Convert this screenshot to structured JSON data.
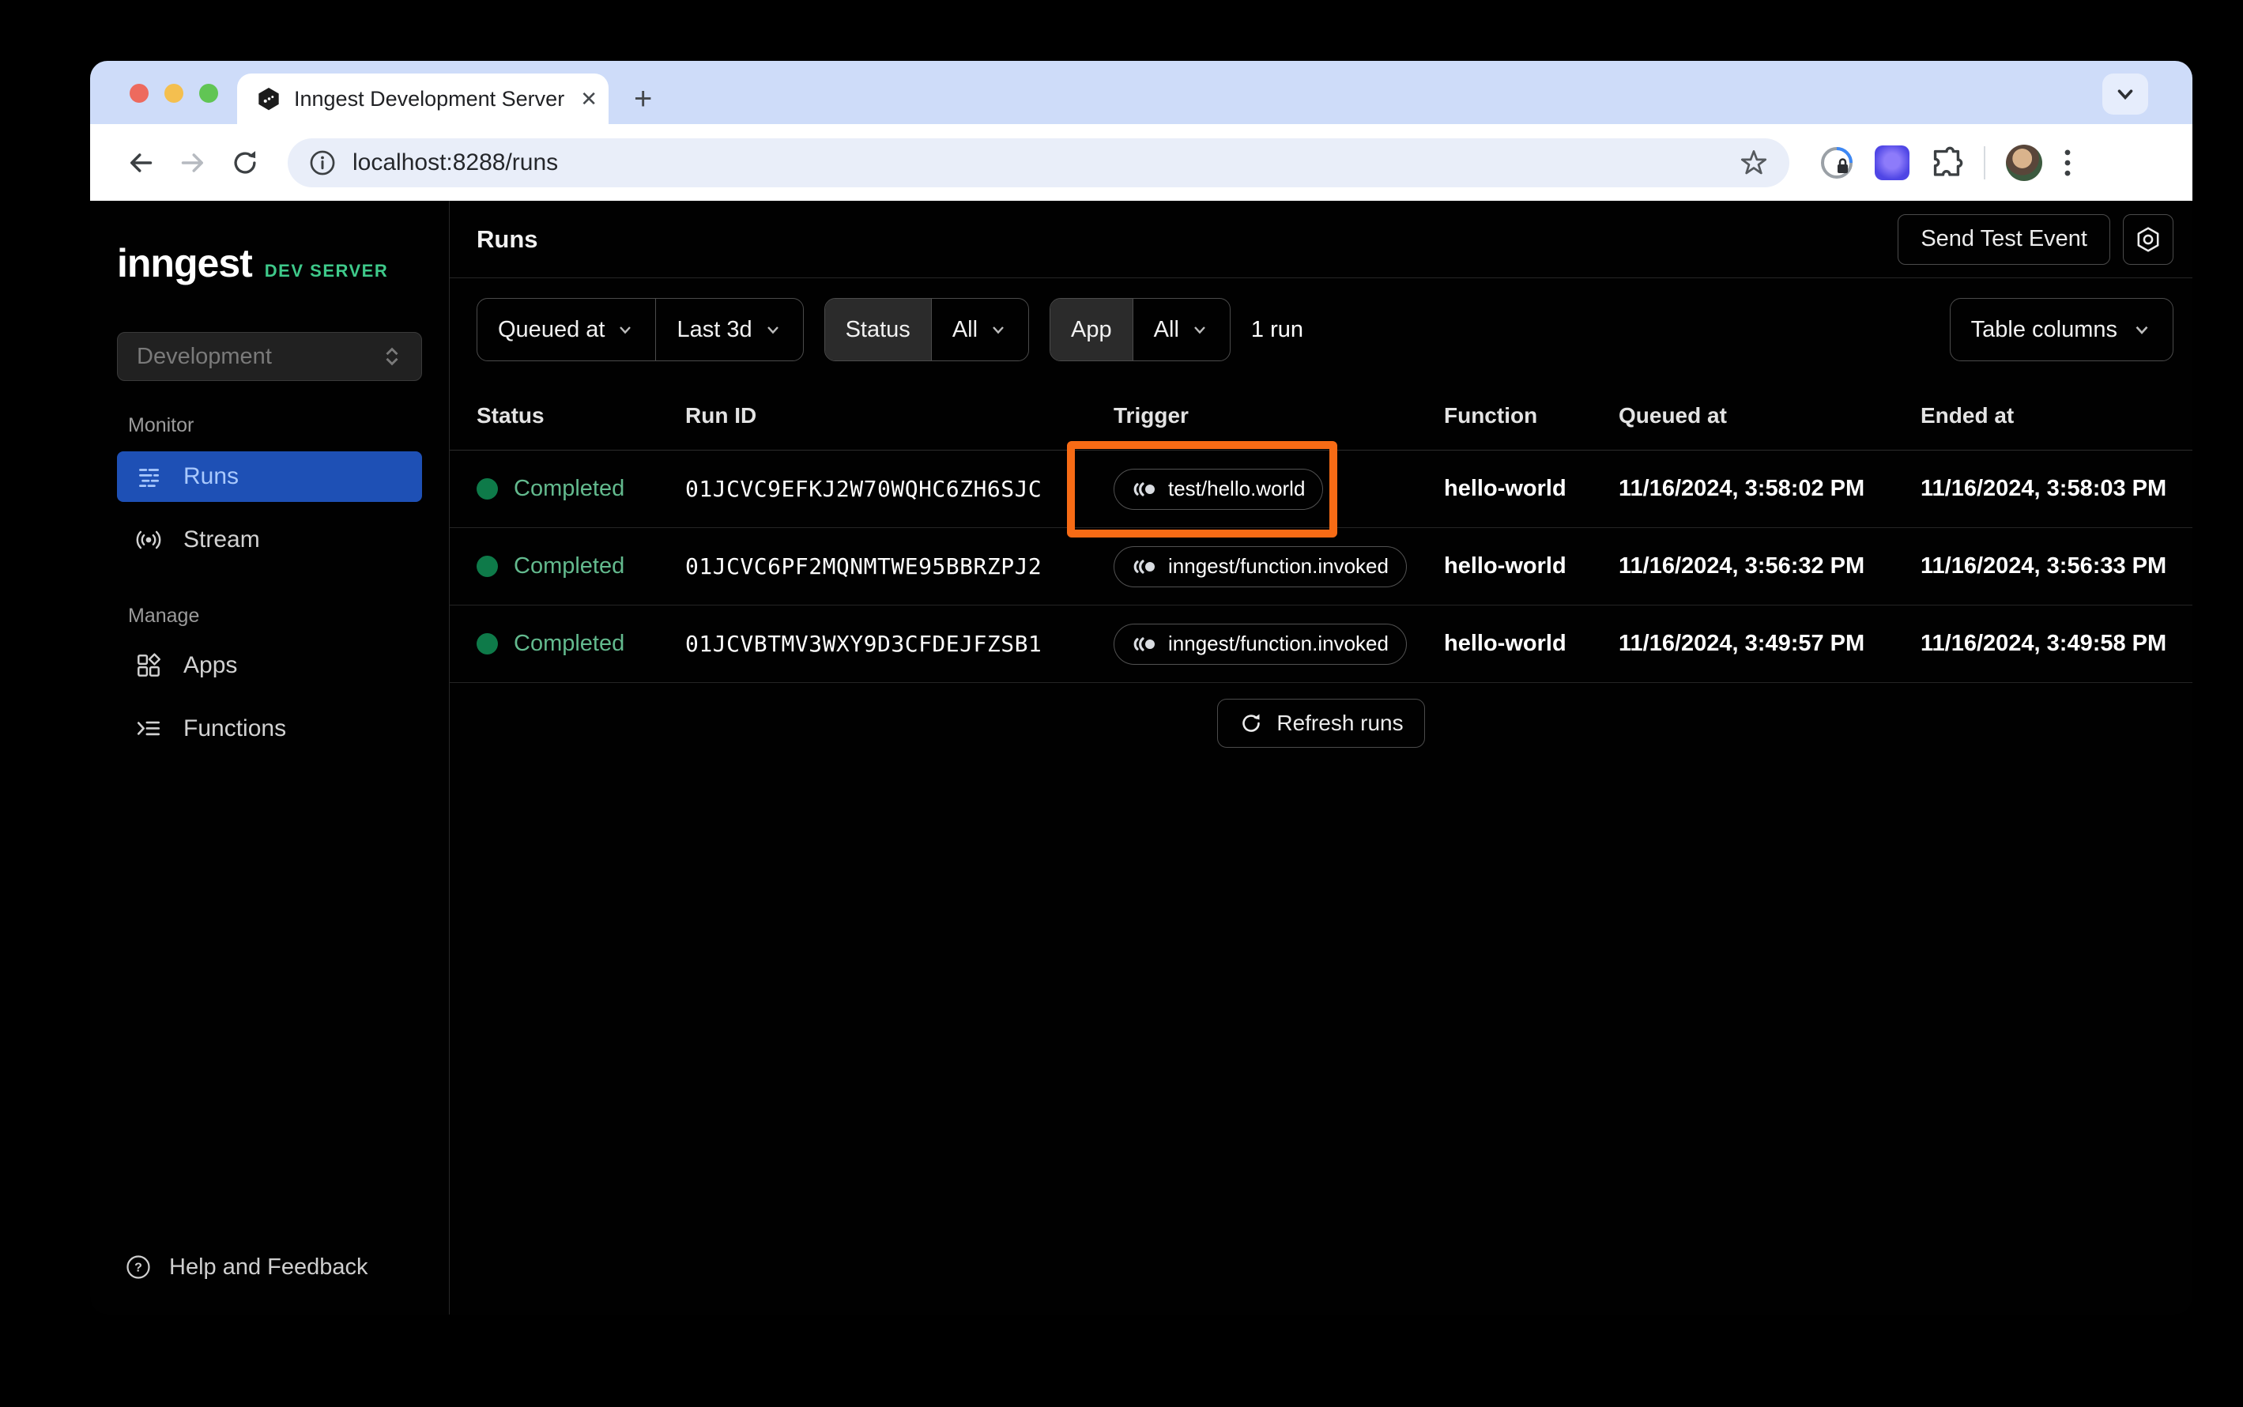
{
  "browser": {
    "tab_title": "Inngest Development Server",
    "url": "localhost:8288/runs"
  },
  "sidebar": {
    "logo": "inngest",
    "badge": "DEV SERVER",
    "environment": "Development",
    "sections": [
      {
        "label": "Monitor",
        "items": [
          {
            "label": "Runs",
            "active": true
          },
          {
            "label": "Stream",
            "active": false
          }
        ]
      },
      {
        "label": "Manage",
        "items": [
          {
            "label": "Apps",
            "active": false
          },
          {
            "label": "Functions",
            "active": false
          }
        ]
      }
    ],
    "help": "Help and Feedback"
  },
  "header": {
    "title": "Runs",
    "send_test_event": "Send Test Event"
  },
  "filters": {
    "queued_at": "Queued at",
    "time_range": "Last 3d",
    "status_label": "Status",
    "status_value": "All",
    "app_label": "App",
    "app_value": "All",
    "run_count": "1 run",
    "table_columns": "Table columns"
  },
  "table": {
    "columns": [
      "Status",
      "Run ID",
      "Trigger",
      "Function",
      "Queued at",
      "Ended at"
    ],
    "rows": [
      {
        "status": "Completed",
        "run_id": "01JCVC9EFKJ2W70WQHC6ZH6SJC",
        "trigger": "test/hello.world",
        "function": "hello-world",
        "queued_at": "11/16/2024, 3:58:02 PM",
        "ended_at": "11/16/2024, 3:58:03 PM",
        "highlighted": true
      },
      {
        "status": "Completed",
        "run_id": "01JCVC6PF2MQNMTWE95BBRZPJ2",
        "trigger": "inngest/function.invoked",
        "function": "hello-world",
        "queued_at": "11/16/2024, 3:56:32 PM",
        "ended_at": "11/16/2024, 3:56:33 PM",
        "highlighted": false
      },
      {
        "status": "Completed",
        "run_id": "01JCVBTMV3WXY9D3CFDEJFZSB1",
        "trigger": "inngest/function.invoked",
        "function": "hello-world",
        "queued_at": "11/16/2024, 3:49:57 PM",
        "ended_at": "11/16/2024, 3:49:58 PM",
        "highlighted": false
      }
    ],
    "refresh_label": "Refresh runs"
  },
  "colors": {
    "accent_blue": "#1e50b5",
    "brand_green": "#3ec98a",
    "status_green_text": "#63ba8e",
    "status_green_dot": "#0e7a49",
    "highlight_orange": "#f76b15",
    "tabstrip_blue": "#cedcf9"
  }
}
